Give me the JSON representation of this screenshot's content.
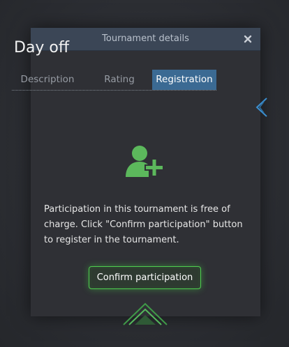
{
  "modal": {
    "title": "Tournament details",
    "close_label": "×"
  },
  "tournament": {
    "name": "Day off"
  },
  "tabs": [
    {
      "label": "Description",
      "active": false
    },
    {
      "label": "Rating",
      "active": false
    },
    {
      "label": "Registration",
      "active": true
    }
  ],
  "registration": {
    "icon": "user-add-icon",
    "description": "Participation in this tournament is free of charge. Click \"Confirm participation\" button to register in the tournament.",
    "confirm_label": "Confirm participation"
  },
  "colors": {
    "background": "#2b2d33",
    "modal_bg": "#2f3035",
    "header_bg": "#3b4656",
    "tab_active_bg": "#3b6a93",
    "accent_green": "#4fcf4f",
    "accent_blue": "#3b8fd0"
  }
}
